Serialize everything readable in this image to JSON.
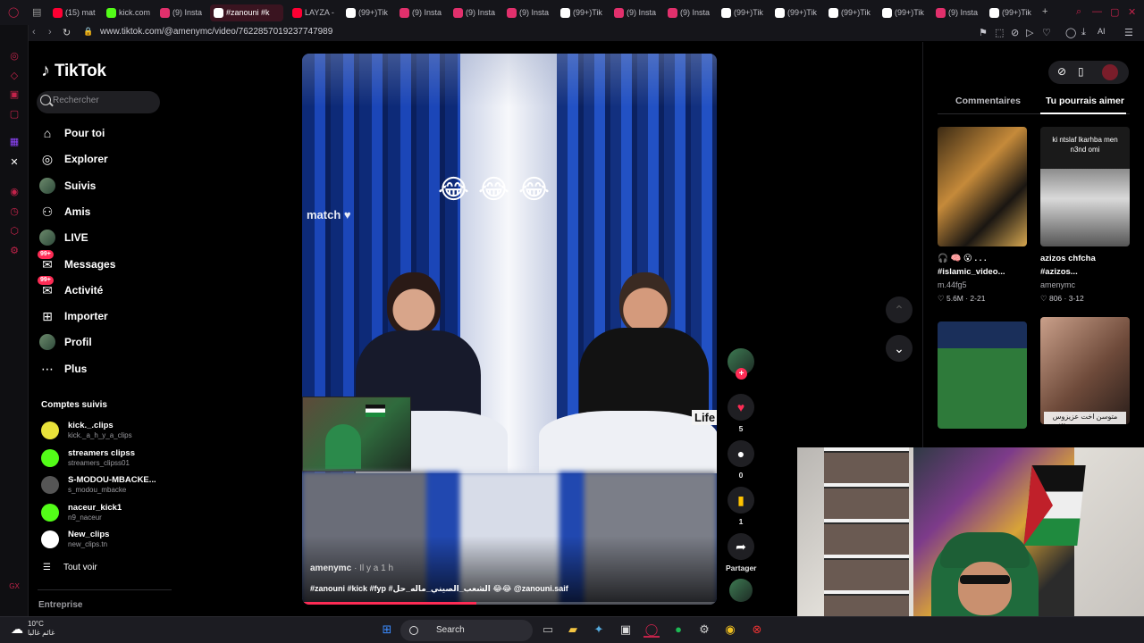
{
  "browser": {
    "tabs": [
      {
        "label": "(15) mat",
        "color": "#ff0033"
      },
      {
        "label": "kick.com",
        "color": "#53fc18"
      },
      {
        "label": "(9) Insta",
        "color": "#e1306c"
      },
      {
        "label": "#zanouni #k",
        "color": "#ffffff",
        "active": true
      },
      {
        "label": "LAYZA -",
        "color": "#ff0033"
      },
      {
        "label": "(99+)Tik",
        "color": "#ffffff"
      },
      {
        "label": "(9) Insta",
        "color": "#e1306c"
      },
      {
        "label": "(9) Insta",
        "color": "#e1306c"
      },
      {
        "label": "(9) Insta",
        "color": "#e1306c"
      },
      {
        "label": "(99+)Tik",
        "color": "#ffffff"
      },
      {
        "label": "(9) Insta",
        "color": "#e1306c"
      },
      {
        "label": "(9) Insta",
        "color": "#e1306c"
      },
      {
        "label": "(99+)Tik",
        "color": "#ffffff"
      },
      {
        "label": "(99+)Tik",
        "color": "#ffffff"
      },
      {
        "label": "(99+)Tik",
        "color": "#ffffff"
      },
      {
        "label": "(99+)Tik",
        "color": "#ffffff"
      },
      {
        "label": "(9) Insta",
        "color": "#e1306c"
      },
      {
        "label": "(99+)Tik",
        "color": "#ffffff"
      }
    ],
    "url": "www.tiktok.com/@amenymc/video/7622857019237747989",
    "accent": "#c2234a"
  },
  "tiktok": {
    "logo_text": "TikTok",
    "search_placeholder": "Rechercher",
    "nav": [
      {
        "label": "Pour toi",
        "icon": "home-icon"
      },
      {
        "label": "Explorer",
        "icon": "compass-icon"
      },
      {
        "label": "Suivis",
        "icon": "avatar"
      },
      {
        "label": "Amis",
        "icon": "friends-icon"
      },
      {
        "label": "LIVE",
        "icon": "avatar"
      },
      {
        "label": "Messages",
        "icon": "messages-icon",
        "badge": "99+"
      },
      {
        "label": "Activité",
        "icon": "activity-icon",
        "badge": "99+"
      },
      {
        "label": "Importer",
        "icon": "upload-icon"
      },
      {
        "label": "Profil",
        "icon": "avatar"
      },
      {
        "label": "Plus",
        "icon": "more-icon"
      }
    ],
    "following_title": "Comptes suivis",
    "following": [
      {
        "name": "kick._.clips",
        "handle": "kick._a_h_y_a_clips",
        "color": "#e8e23a"
      },
      {
        "name": "streamers clipss",
        "handle": "streamers_clipss01",
        "color": "#53fc18"
      },
      {
        "name": "S-MODOU-MBACKE...",
        "handle": "s_modou_mbacke",
        "color": "#555555"
      },
      {
        "name": "naceur_kick1",
        "handle": "n9_naceur",
        "color": "#53fc18"
      },
      {
        "name": "New_clips",
        "handle": "new_clips.tn",
        "color": "#ffffff"
      }
    ],
    "see_all": "Tout voir",
    "footer": "Entreprise"
  },
  "video": {
    "emoji": [
      "😂",
      "😂",
      "😂"
    ],
    "watermark": "match",
    "sign_text": "Life",
    "author": "amenymc",
    "time": "· Il y a 1 h",
    "caption": "#zanouni #kick #fyp #الشعب_الصيني_ماله_حل 😂😂 @zanouni.saif",
    "progress": 0.42,
    "actions": {
      "likes": "5",
      "comments": "0",
      "saves": "1",
      "share_label": "Partager"
    }
  },
  "right_panel": {
    "tabs": [
      "Commentaires",
      "Tu pourrais aimer"
    ],
    "active_tab": 1,
    "cards": [
      {
        "overlay": "",
        "title": "🎧 🧠 😮 . . .",
        "subtitle": "#islamic_video...",
        "user": "m.44fg5",
        "stats": "♡ 5.6M · 2-21",
        "bg": "linear-gradient(135deg,#3b2a14,#c58a3a 40%,#1a1612 70%,#d6a750)"
      },
      {
        "overlay": "ki ntslaf lkarhba men n3nd omi",
        "title": "azizos chfcha",
        "subtitle": "#azizos...",
        "user": "amenymc",
        "stats": "♡ 806 · 3-12",
        "bg": "linear-gradient(#1a1a1a 0 35%,#8c8c8c 35%,#d9d9d9 60%,#555 100%)"
      },
      {
        "overlay": "",
        "title": "",
        "subtitle": "",
        "user": "",
        "stats": "",
        "bg": "linear-gradient(#1a2f5a 0 25%,#2e7a3a 25% 100%)"
      },
      {
        "overlay": "متوسن اخت عزيزوس تصرح عن سبب طلاق عزيزو و امنة",
        "title": "",
        "subtitle": "",
        "user": "",
        "stats": "",
        "bg": "linear-gradient(135deg,#caa08a,#6e4a3a 55%,#2a1e1a)"
      }
    ]
  },
  "taskbar": {
    "temp": "10°C",
    "weather_text": "غائم غالبا",
    "search_label": "Search"
  }
}
